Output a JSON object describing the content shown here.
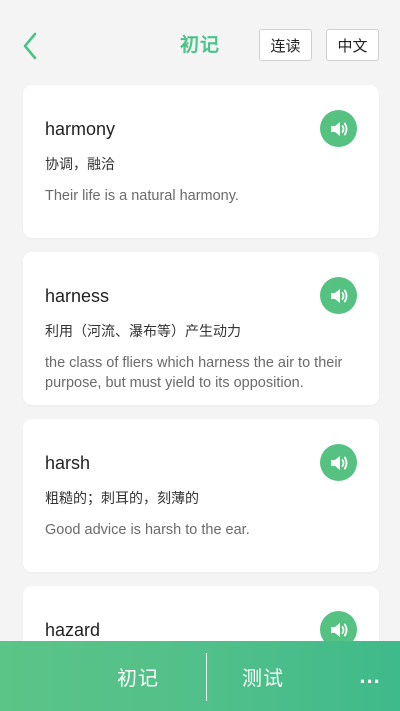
{
  "header": {
    "title": "初记",
    "read_button": "连读",
    "lang_button": "中文"
  },
  "colors": {
    "accent": "#4cc38a",
    "speaker": "#56c282",
    "bar_start": "#5bc487",
    "bar_end": "#3fba8a"
  },
  "cards": [
    {
      "word": "harmony",
      "meaning": "协调，融洽",
      "example": "Their life is a natural harmony."
    },
    {
      "word": "harness",
      "meaning": "利用（河流、瀑布等）产生动力",
      "example": "the class of fliers which harness the air to their purpose, but must yield to its opposition."
    },
    {
      "word": "harsh",
      "meaning": "粗糙的；刺耳的，刻薄的",
      "example": "Good advice is harsh to the ear."
    },
    {
      "word": "hazard",
      "meaning": "",
      "example": ""
    }
  ],
  "bottom_bar": {
    "tab_1": "初记",
    "tab_2": "测试",
    "more": "..."
  }
}
